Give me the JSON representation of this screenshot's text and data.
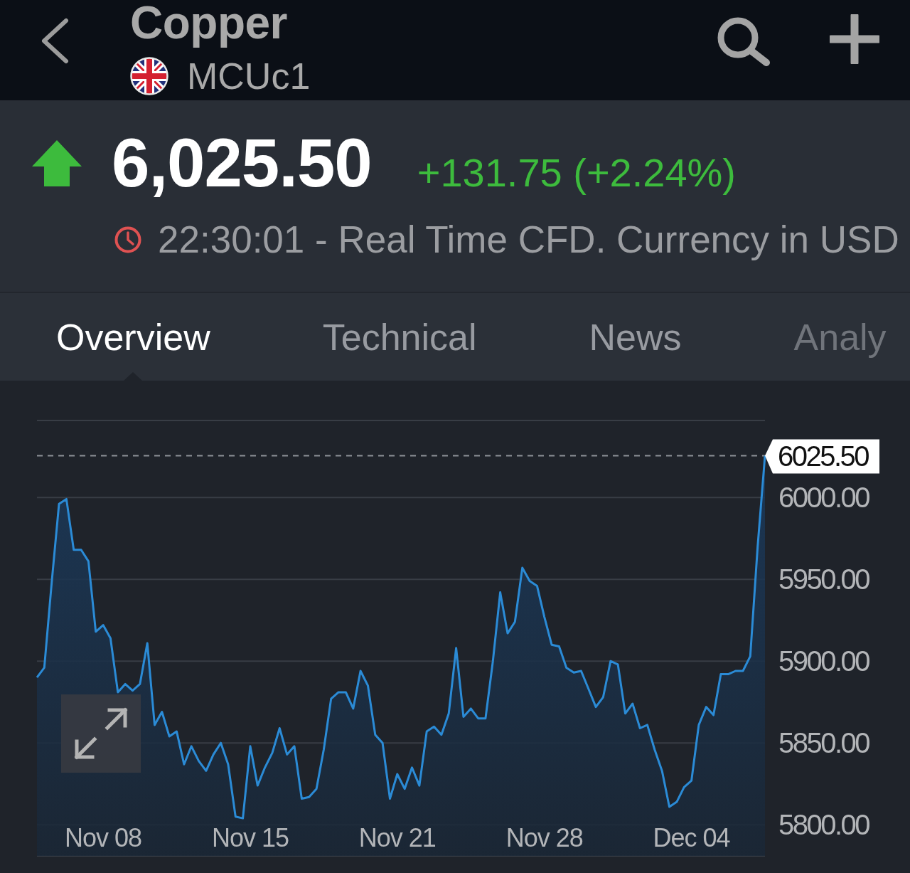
{
  "header": {
    "title": "Copper",
    "symbol": "MCUc1"
  },
  "quote": {
    "up": true,
    "price": "6,025.50",
    "change": "+131.75 (+2.24%)",
    "timestamp": "22:30:01 - Real Time CFD. Currency in USD"
  },
  "tabs": [
    {
      "label": "Overview",
      "selected": true
    },
    {
      "label": "Technical",
      "selected": false
    },
    {
      "label": "News",
      "selected": false
    },
    {
      "label": "Analy",
      "selected": false
    }
  ],
  "chart": {
    "chart_data": {
      "type": "area",
      "grid": true,
      "ylim": [
        5781,
        6047
      ],
      "categories": [
        null,
        null,
        null,
        null,
        null,
        null,
        null,
        null,
        null,
        "Nov 08",
        null,
        null,
        null,
        null,
        null,
        null,
        null,
        null,
        null,
        null,
        null,
        null,
        null,
        null,
        null,
        null,
        null,
        null,
        null,
        "Nov 15",
        null,
        null,
        null,
        null,
        null,
        null,
        null,
        null,
        null,
        null,
        null,
        null,
        null,
        null,
        null,
        null,
        null,
        null,
        null,
        "Nov 21",
        null,
        null,
        null,
        null,
        null,
        null,
        null,
        null,
        null,
        null,
        null,
        null,
        null,
        null,
        null,
        null,
        null,
        null,
        null,
        "Nov 28",
        null,
        null,
        null,
        null,
        null,
        null,
        null,
        null,
        null,
        null,
        null,
        null,
        null,
        null,
        null,
        null,
        null,
        null,
        null,
        "Dec 04",
        null,
        null,
        null,
        null,
        null,
        null,
        null,
        null,
        null,
        null
      ],
      "yticks": [
        {
          "value": 5800,
          "label": "5800.00"
        },
        {
          "value": 5850,
          "label": "5850.00"
        },
        {
          "value": 5900,
          "label": "5900.00"
        },
        {
          "value": 5950,
          "label": "5950.00"
        },
        {
          "value": 6000,
          "label": "6000.00"
        }
      ],
      "values": [
        5890,
        5896,
        5948,
        5996,
        5999,
        5968,
        5968,
        5961,
        5918,
        5922,
        5914,
        5881,
        5886,
        5882,
        5886,
        5911,
        5861,
        5869,
        5854,
        5857,
        5837,
        5848,
        5839,
        5833,
        5843,
        5850,
        5837,
        5805,
        5804,
        5848,
        5824,
        5835,
        5844,
        5859,
        5843,
        5848,
        5816,
        5817,
        5822,
        5846,
        5877,
        5881,
        5881,
        5871,
        5894,
        5885,
        5855,
        5850,
        5816,
        5831,
        5822,
        5835,
        5824,
        5857,
        5860,
        5855,
        5868,
        5908,
        5866,
        5871,
        5865,
        5865,
        5900,
        5942,
        5917,
        5924,
        5957,
        5949,
        5946,
        5927,
        5910,
        5909,
        5896,
        5893,
        5894,
        5883,
        5872,
        5878,
        5900,
        5898,
        5868,
        5874,
        5859,
        5861,
        5846,
        5833,
        5811,
        5814,
        5823,
        5827,
        5861,
        5872,
        5867,
        5892,
        5892,
        5894,
        5894,
        5903,
        5970,
        6025.5
      ],
      "ref_lines": [
        {
          "axis": "y",
          "value": 6025.5,
          "label": "6025.50"
        }
      ]
    }
  }
}
